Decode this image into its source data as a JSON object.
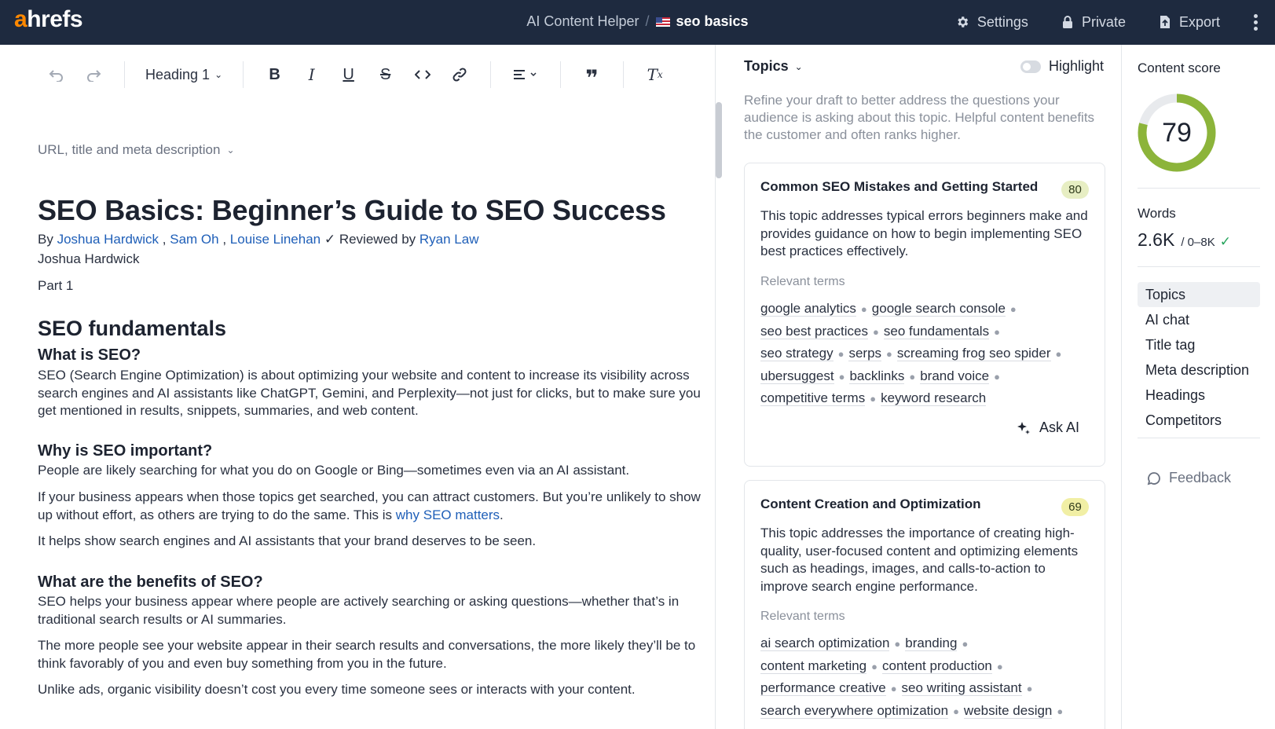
{
  "app": {
    "logo_prefix": "a",
    "logo_rest": "hrefs",
    "breadcrumb_root": "AI Content Helper",
    "breadcrumb_separator": "/",
    "document_name": "seo basics",
    "flag_icon": "us-flag-icon",
    "actions": {
      "settings": "Settings",
      "private": "Private",
      "export": "Export"
    }
  },
  "toolbar": {
    "heading_select": "Heading 1",
    "icons": [
      "undo-icon",
      "redo-icon",
      "bold-icon",
      "italic-icon",
      "underline-icon",
      "strikethrough-icon",
      "code-icon",
      "link-icon",
      "align-icon",
      "quote-icon",
      "clear-format-icon"
    ]
  },
  "editor": {
    "meta_toggle": "URL, title and meta description",
    "title": "SEO Basics: Beginner’s Guide to SEO Success",
    "byline": {
      "by": "By",
      "author1": "Joshua Hardwick",
      "sep1": ",",
      "author2": "Sam Oh",
      "sep2": ",",
      "author3": "Louise Linehan",
      "reviewed": "✓ Reviewed by",
      "reviewer": "Ryan Law"
    },
    "author_line": "Joshua Hardwick",
    "part": "Part 1",
    "section_fundamentals": "SEO fundamentals",
    "h_what": "What is SEO?",
    "p_what": "SEO (Search Engine Optimization) is about optimizing your website and content to increase its visibility across search engines and AI assistants like ChatGPT, Gemini, and Perplexity—not just for clicks, but to make sure you get mentioned in results, snippets, summaries, and web content.",
    "h_why": "Why is SEO important?",
    "p_why1": "People are likely searching for what you do on Google or Bing—sometimes even via an AI assistant.",
    "p_why2_pre": "If your business appears when those topics get searched, you can attract customers. But you’re unlikely to show up without effort, as others are trying to do the same. This is ",
    "p_why2_link": "why SEO matters",
    "p_why2_post": ".",
    "p_why3": "It helps show search engines and AI assistants that your brand deserves to be seen.",
    "h_benefits": "What are the benefits of SEO?",
    "p_ben1": "SEO helps your business appear where people are actively searching or asking questions—whether that’s in traditional search results or AI summaries.",
    "p_ben2": "The more people see your website appear in their search results and conversations, the more likely they’ll be to think favorably of you and even buy something from you in the future.",
    "p_ben3": "Unlike ads, organic visibility doesn’t cost you every time someone sees or interacts with your content."
  },
  "topics_panel": {
    "header": "Topics",
    "highlight_label": "Highlight",
    "description": "Refine your draft to better address the questions your audience is asking about this topic. Helpful content benefits the customer and often ranks higher.",
    "relevant_terms_label": "Relevant terms",
    "ask_ai": "Ask AI",
    "cards": [
      {
        "title": "Common SEO Mistakes and Getting Started",
        "score": "80",
        "body": "This topic addresses typical errors beginners make and provides guidance on how to begin implementing SEO best practices effectively.",
        "terms": [
          "google analytics",
          "google search console",
          "seo best practices",
          "seo fundamentals",
          "seo strategy",
          "serps",
          "screaming frog seo spider",
          "ubersuggest",
          "backlinks",
          "brand voice",
          "competitive terms",
          "keyword research"
        ]
      },
      {
        "title": "Content Creation and Optimization",
        "score": "69",
        "body": "This topic addresses the importance of creating high-quality, user-focused content and optimizing elements such as headings, images, and calls-to-action to improve search engine performance.",
        "terms": [
          "ai search optimization",
          "branding",
          "content marketing",
          "content production",
          "performance creative",
          "seo writing assistant",
          "search everywhere optimization",
          "website design"
        ]
      }
    ]
  },
  "sidebar": {
    "content_score_label": "Content score",
    "content_score": 79,
    "words_label": "Words",
    "words_value": "2.6K",
    "words_range": "/ 0–8K",
    "words_check": "✓",
    "nav": [
      "Topics",
      "AI chat",
      "Title tag",
      "Meta description",
      "Headings",
      "Competitors"
    ],
    "feedback": "Feedback",
    "colors": {
      "score_arc": "#8cb43a",
      "score_track": "#e8eaed"
    }
  }
}
